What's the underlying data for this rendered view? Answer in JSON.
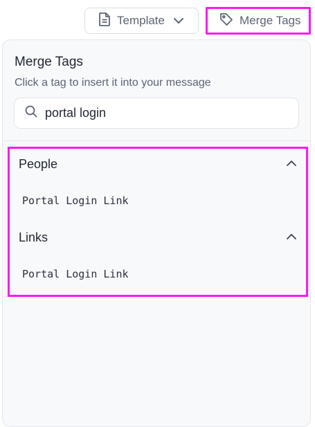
{
  "toolbar": {
    "template_label": "Template",
    "merge_tags_label": "Merge Tags"
  },
  "panel": {
    "title": "Merge Tags",
    "subtitle": "Click a tag to insert it into your message",
    "search": {
      "value": "portal login",
      "icon": "search-icon"
    },
    "groups": [
      {
        "title": "People",
        "expanded": true,
        "items": [
          "Portal Login Link"
        ]
      },
      {
        "title": "Links",
        "expanded": true,
        "items": [
          "Portal Login Link"
        ]
      }
    ]
  },
  "colors": {
    "highlight": "#ff17f1",
    "text_primary": "#1f2530",
    "text_secondary": "#5b6372",
    "panel_bg": "#f8f9fb"
  }
}
